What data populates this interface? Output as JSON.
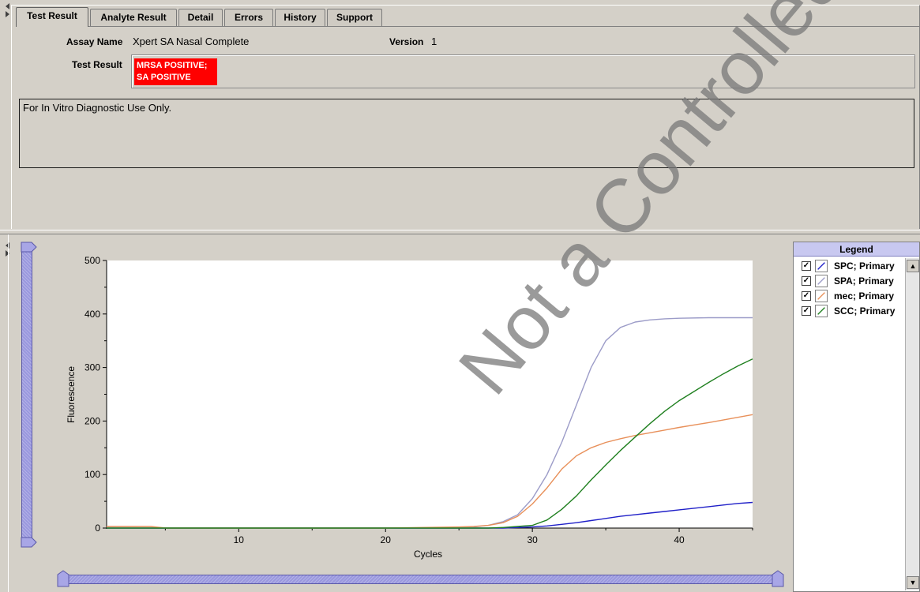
{
  "tabs": [
    {
      "label": "Test Result",
      "active": true
    },
    {
      "label": "Analyte Result",
      "active": false
    },
    {
      "label": "Detail",
      "active": false
    },
    {
      "label": "Errors",
      "active": false
    },
    {
      "label": "History",
      "active": false
    },
    {
      "label": "Support",
      "active": false
    }
  ],
  "test_info": {
    "assay_name_label": "Assay Name",
    "assay_name": "Xpert SA Nasal Complete",
    "version_label": "Version",
    "version": "1",
    "test_result_label": "Test Result",
    "result_lines": [
      "MRSA POSITIVE;",
      "SA POSITIVE"
    ],
    "result_color": "#ff0000"
  },
  "notes": "For In Vitro Diagnostic Use Only.",
  "legend": {
    "header": "Legend",
    "items": [
      {
        "label": "SPC; Primary",
        "checked": true,
        "color": "#2020c8"
      },
      {
        "label": "SPA; Primary",
        "checked": true,
        "color": "#9c9cc8"
      },
      {
        "label": "mec; Primary",
        "checked": true,
        "color": "#e8905a"
      },
      {
        "label": "SCC; Primary",
        "checked": true,
        "color": "#208020"
      }
    ]
  },
  "watermark": "Not a Controlled Copy",
  "chart_data": {
    "type": "line",
    "xlabel": "Cycles",
    "ylabel": "Fluorescence",
    "xlim": [
      1,
      45
    ],
    "ylim": [
      0,
      500
    ],
    "x_ticks": [
      10,
      20,
      30,
      40
    ],
    "y_ticks": [
      0,
      100,
      200,
      300,
      400,
      500
    ],
    "series": [
      {
        "name": "SPC; Primary",
        "color": "#2020c8",
        "x": [
          1,
          10,
          20,
          26,
          28,
          29,
          30,
          31,
          32,
          33,
          34,
          35,
          36,
          37,
          38,
          39,
          40,
          41,
          42,
          43,
          44,
          45
        ],
        "y": [
          0,
          0,
          0,
          0,
          0,
          1,
          2,
          4,
          7,
          10,
          14,
          18,
          22,
          25,
          28,
          31,
          34,
          37,
          40,
          43,
          46,
          48
        ]
      },
      {
        "name": "SPA; Primary",
        "color": "#9c9cc8",
        "x": [
          1,
          10,
          20,
          25,
          26,
          27,
          28,
          29,
          30,
          31,
          32,
          33,
          34,
          35,
          36,
          37,
          38,
          39,
          40,
          42,
          45
        ],
        "y": [
          1,
          0,
          0,
          1,
          2,
          5,
          12,
          25,
          55,
          100,
          160,
          230,
          300,
          350,
          375,
          385,
          389,
          391,
          392,
          393,
          393
        ]
      },
      {
        "name": "mec; Primary",
        "color": "#e8905a",
        "x": [
          1,
          4,
          5,
          10,
          20,
          25,
          26,
          27,
          28,
          29,
          30,
          31,
          32,
          33,
          34,
          35,
          36,
          37,
          38,
          39,
          40,
          42,
          45
        ],
        "y": [
          3,
          3,
          0,
          0,
          0,
          2,
          3,
          5,
          10,
          22,
          45,
          75,
          110,
          135,
          150,
          160,
          167,
          173,
          178,
          183,
          188,
          197,
          212
        ]
      },
      {
        "name": "SCC; Primary",
        "color": "#208020",
        "x": [
          1,
          10,
          20,
          27,
          28,
          29,
          30,
          31,
          32,
          33,
          34,
          35,
          36,
          37,
          38,
          39,
          40,
          41,
          42,
          43,
          44,
          45
        ],
        "y": [
          0,
          0,
          0,
          0,
          1,
          3,
          5,
          15,
          35,
          60,
          90,
          118,
          145,
          170,
          195,
          218,
          238,
          255,
          272,
          288,
          303,
          316
        ]
      }
    ]
  }
}
